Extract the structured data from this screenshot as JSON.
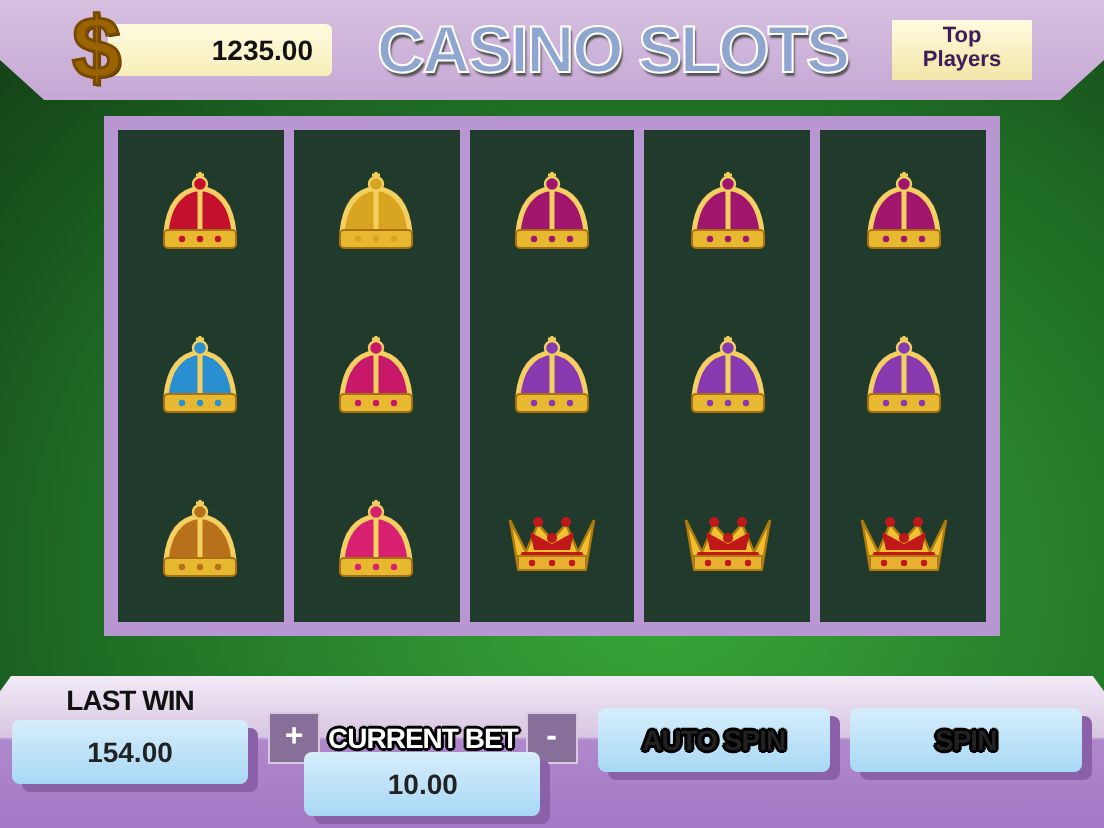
{
  "header": {
    "balance_icon": "$",
    "balance": "1235.00",
    "title": "CASINO SLOTS",
    "top_players_button": "Top Players"
  },
  "reels": [
    {
      "symbols": [
        {
          "kind": "domed",
          "color": "#c4102c"
        },
        {
          "kind": "domed",
          "color": "#2a8fd0"
        },
        {
          "kind": "domed",
          "color": "#b8701a"
        }
      ]
    },
    {
      "symbols": [
        {
          "kind": "domed",
          "color": "#d9a520"
        },
        {
          "kind": "domed",
          "color": "#c8186a"
        },
        {
          "kind": "domed",
          "color": "#d82070"
        }
      ]
    },
    {
      "symbols": [
        {
          "kind": "domed",
          "color": "#a0166e"
        },
        {
          "kind": "domed",
          "color": "#8a3ab0"
        },
        {
          "kind": "open",
          "color": "#c01818"
        }
      ]
    },
    {
      "symbols": [
        {
          "kind": "domed",
          "color": "#a0166e"
        },
        {
          "kind": "domed",
          "color": "#8a3ab0"
        },
        {
          "kind": "open",
          "color": "#c01818"
        }
      ]
    },
    {
      "symbols": [
        {
          "kind": "domed",
          "color": "#a0166e"
        },
        {
          "kind": "domed",
          "color": "#8a3ab0"
        },
        {
          "kind": "open",
          "color": "#c01818"
        }
      ]
    }
  ],
  "footer": {
    "last_win_label": "LAST WIN",
    "last_win": "154.00",
    "increase_bet_button": "+",
    "current_bet_label": "CURRENT BET",
    "decrease_bet_button": "-",
    "current_bet": "10.00",
    "auto_spin_button": "AUTO SPIN",
    "spin_button": "SPIN"
  }
}
